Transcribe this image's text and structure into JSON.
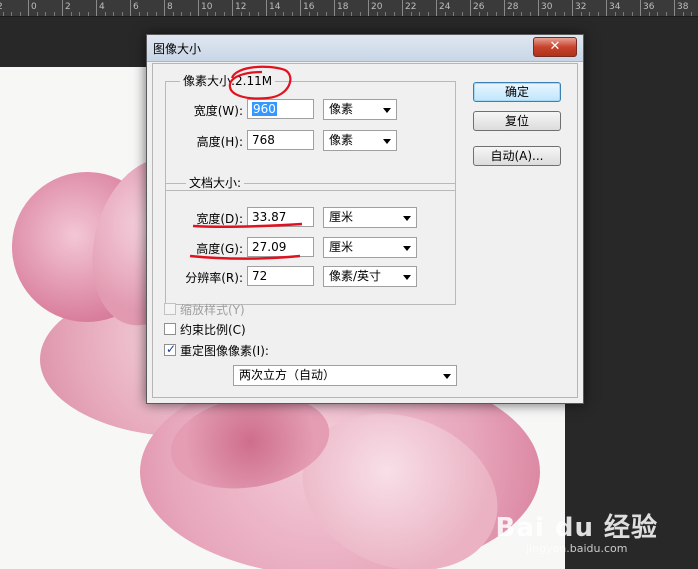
{
  "ruler": {
    "labels": [
      "8",
      "6",
      "4",
      "2",
      "0",
      "2",
      "4",
      "6",
      "8",
      "10",
      "12",
      "14",
      "16",
      "18",
      "20",
      "22",
      "24",
      "26",
      "28",
      "30",
      "32",
      "34",
      "36",
      "38",
      "40"
    ]
  },
  "dialog": {
    "title": "图像大小",
    "close_symbol": "✕",
    "pixel_dimensions": {
      "group_label": "像素大小:2.11M",
      "width_label": "宽度(W):",
      "width_value": "960",
      "width_unit": "像素",
      "height_label": "高度(H):",
      "height_value": "768",
      "height_unit": "像素"
    },
    "document_size": {
      "group_label": "文档大小:",
      "width_label": "宽度(D):",
      "width_value": "33.87",
      "width_unit": "厘米",
      "height_label": "高度(G):",
      "height_value": "27.09",
      "height_unit": "厘米",
      "resolution_label": "分辨率(R):",
      "resolution_value": "72",
      "resolution_unit": "像素/英寸"
    },
    "options": {
      "scale_styles": {
        "label": "缩放样式(Y)",
        "checked": false,
        "enabled": false
      },
      "constrain": {
        "label": "约束比例(C)",
        "checked": false,
        "enabled": true
      },
      "resample": {
        "label": "重定图像像素(I):",
        "checked": true,
        "enabled": true
      },
      "resample_method": "两次立方（自动）"
    },
    "buttons": {
      "ok": "确定",
      "reset": "复位",
      "auto": "自动(A)..."
    }
  },
  "annotation_color": "#e0121f",
  "watermark": {
    "brand": "Bai du 经验",
    "url": "jingyan.baidu.com"
  }
}
